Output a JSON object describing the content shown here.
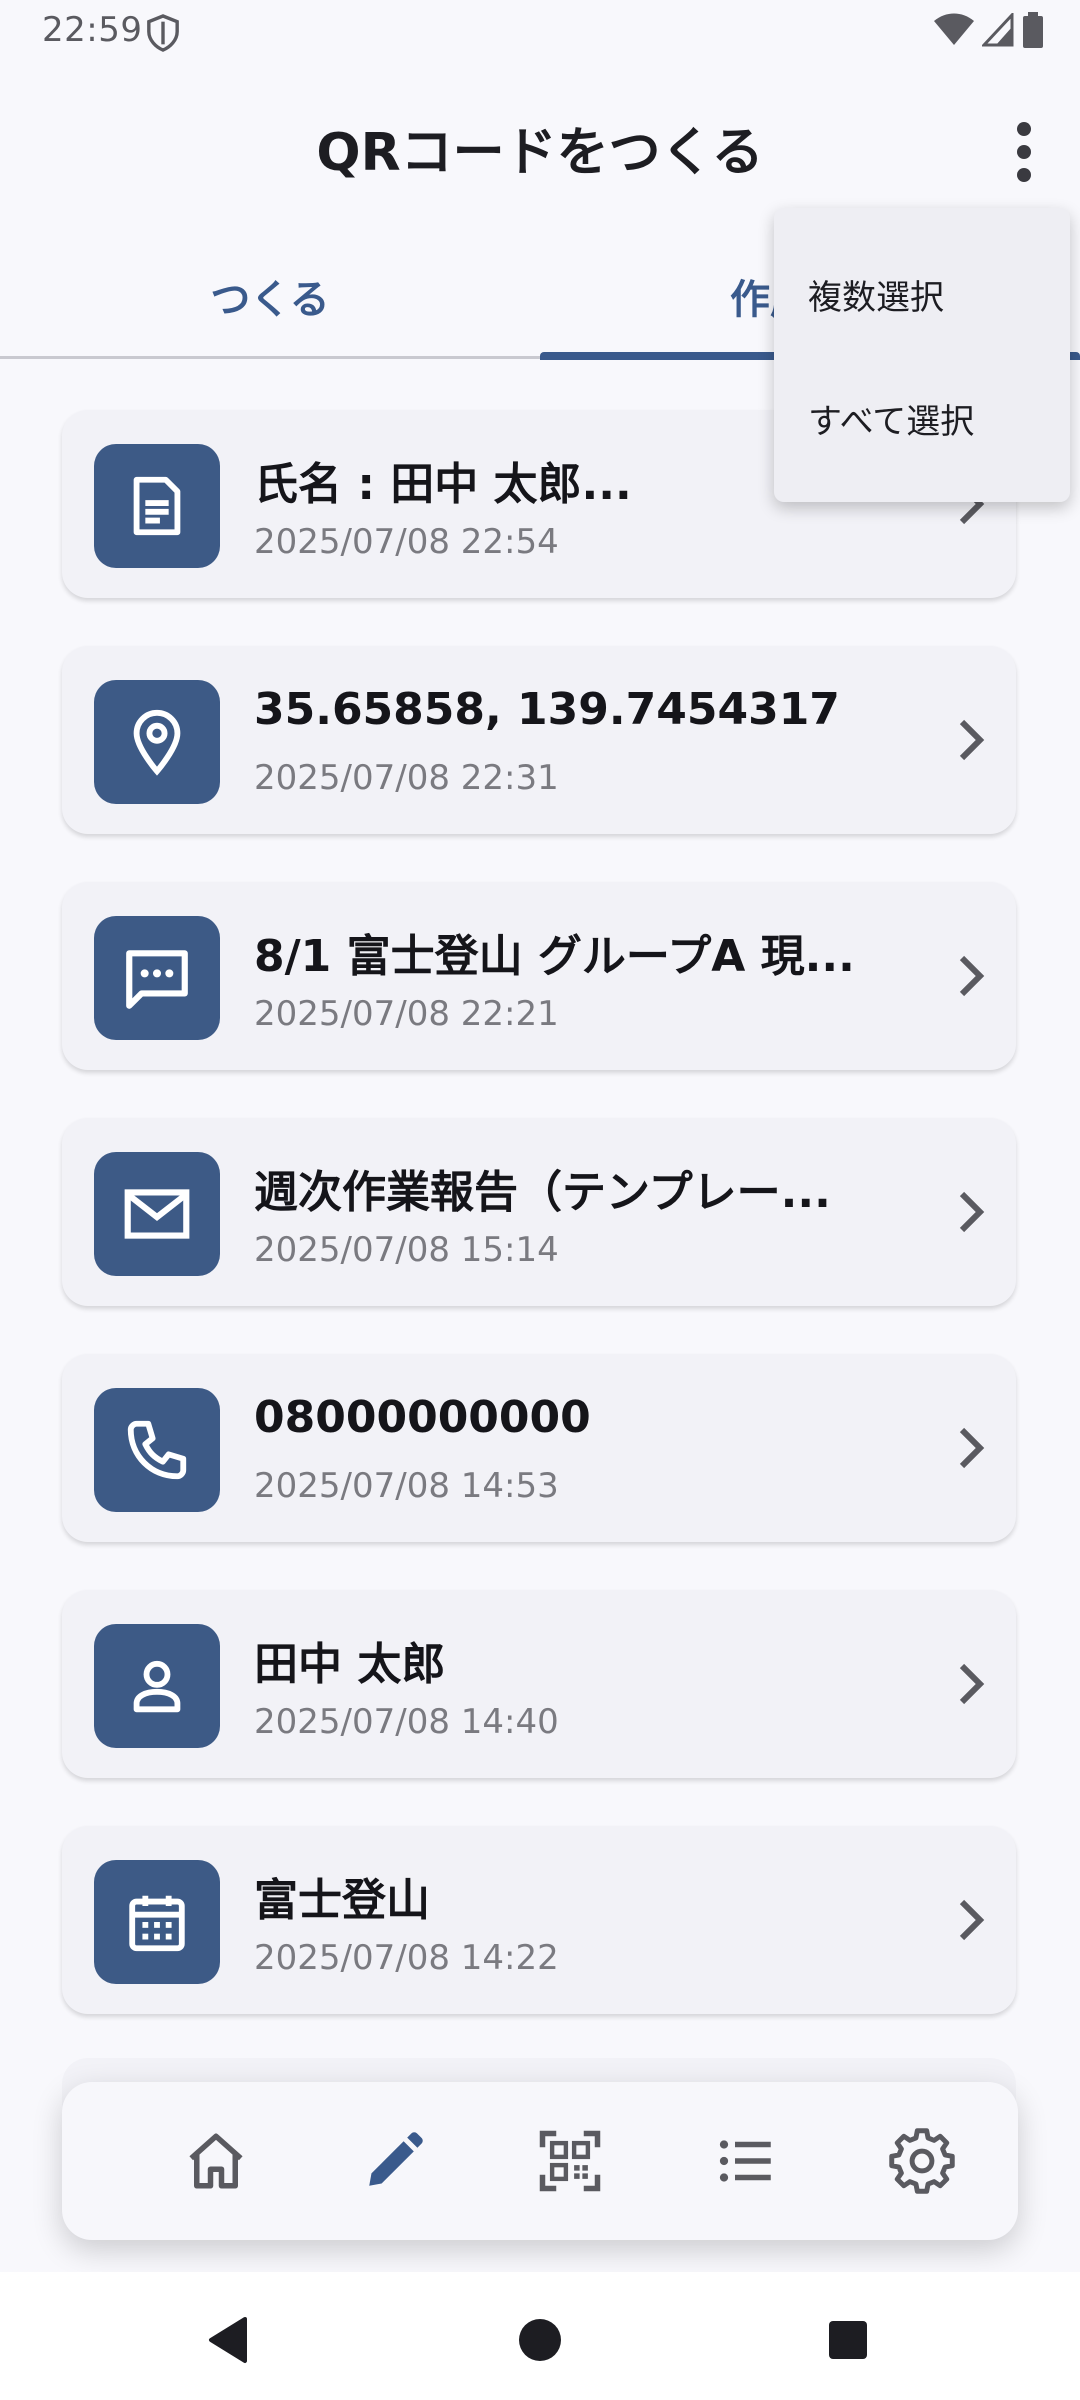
{
  "status": {
    "time": "22:59"
  },
  "header": {
    "title": "QRコードをつくる"
  },
  "tabs": {
    "create": "つくる",
    "history": "作成履歴"
  },
  "history": [
    {
      "icon": "document-icon",
      "title": "氏名 : 田中 太郎...",
      "date": "2025/07/08 22:54"
    },
    {
      "icon": "location-pin-icon",
      "title": "35.65858, 139.7454317",
      "date": "2025/07/08 22:31"
    },
    {
      "icon": "message-icon",
      "title": "8/1 富士登山 グループA 現...",
      "date": "2025/07/08 22:21"
    },
    {
      "icon": "mail-icon",
      "title": "週次作業報告（テンプレー...",
      "date": "2025/07/08 15:14"
    },
    {
      "icon": "phone-icon",
      "title": "08000000000",
      "date": "2025/07/08 14:53"
    },
    {
      "icon": "person-icon",
      "title": "田中 太郎",
      "date": "2025/07/08 14:40"
    },
    {
      "icon": "calendar-icon",
      "title": "富士登山",
      "date": "2025/07/08 14:22"
    }
  ],
  "menu": {
    "multi_select": "複数選択",
    "select_all": "すべて選択"
  },
  "bottom_nav": [
    "home-icon",
    "pencil-icon",
    "qr-scan-icon",
    "list-icon",
    "gear-icon"
  ],
  "colors": {
    "accent": "#3a5a8c",
    "icon_bg": "#3d5a86",
    "card_bg": "#f2f2f7",
    "page_bg": "#f8f8fc"
  }
}
